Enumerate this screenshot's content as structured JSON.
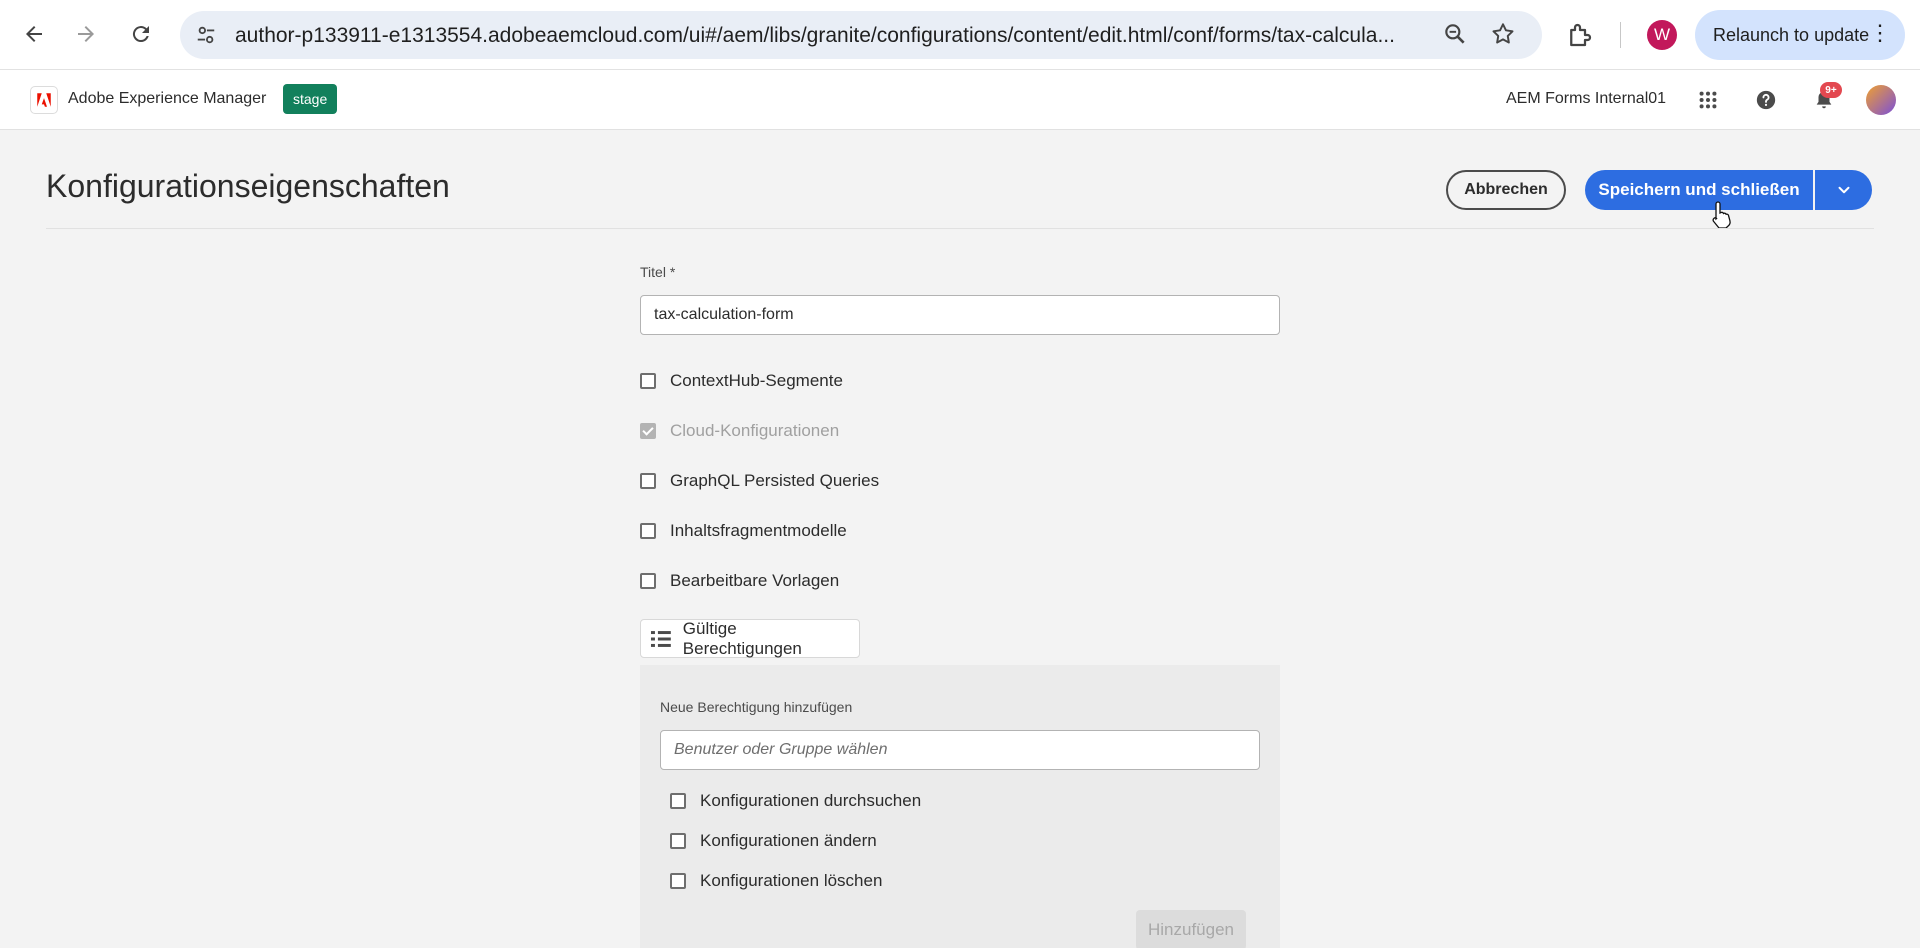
{
  "browser": {
    "url": "author-p133911-e1313554.adobeaemcloud.com/ui#/aem/libs/granite/configurations/content/edit.html/conf/forms/tax-calcula...",
    "profile_initial": "W",
    "relaunch_label": "Relaunch to update",
    "icons": [
      "back-arrow-icon",
      "forward-arrow-icon",
      "reload-icon",
      "site-settings-icon",
      "zoom-icon",
      "bookmark-star-icon",
      "extensions-icon",
      "more-vert-icon"
    ]
  },
  "header": {
    "product_name": "Adobe Experience Manager",
    "environment": "stage",
    "org_name": "AEM Forms Internal01",
    "notification_count": "9+",
    "icons": [
      "adobe-logo-icon",
      "apps-grid-icon",
      "help-icon",
      "bell-icon"
    ]
  },
  "page": {
    "title": "Konfigurationseigenschaften",
    "cancel_label": "Abbrechen",
    "save_label": "Speichern und schließen"
  },
  "form": {
    "title_label": "Titel *",
    "title_value": "tax-calculation-form",
    "checkboxes": [
      {
        "label": "ContextHub-Segmente",
        "checked": false,
        "disabled": false
      },
      {
        "label": "Cloud-Konfigurationen",
        "checked": true,
        "disabled": true
      },
      {
        "label": "GraphQL Persisted Queries",
        "checked": false,
        "disabled": false
      },
      {
        "label": "Inhaltsfragmentmodelle",
        "checked": false,
        "disabled": false
      },
      {
        "label": "Bearbeitbare Vorlagen",
        "checked": false,
        "disabled": false
      }
    ],
    "permissions_button": "Gültige Berechtigungen"
  },
  "permissions": {
    "add_label": "Neue Berechtigung hinzufügen",
    "input_placeholder": "Benutzer oder Gruppe wählen",
    "checkboxes": [
      {
        "label": "Konfigurationen durchsuchen",
        "checked": false
      },
      {
        "label": "Konfigurationen ändern",
        "checked": false
      },
      {
        "label": "Konfigurationen löschen",
        "checked": false
      }
    ],
    "add_button": "Hinzufügen"
  },
  "colors": {
    "primary": "#2d6de1",
    "env_badge": "#12805c",
    "profile": "#c2185b",
    "notification": "#e34850"
  }
}
